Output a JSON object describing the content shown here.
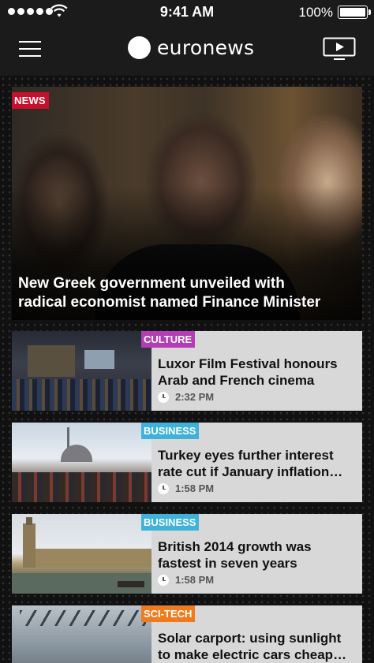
{
  "status_bar": {
    "time": "9:41 AM",
    "battery": "100%"
  },
  "header": {
    "logo_text": "euronews",
    "menu_icon": "hamburger-menu-icon",
    "video_icon": "play-video-icon"
  },
  "hero": {
    "category": "NEWS",
    "category_color": "#c8102e",
    "title_line1": "New Greek government unveiled with",
    "title_line2": "radical economist named Finance Minister"
  },
  "articles": [
    {
      "category": "CULTURE",
      "category_color": "#b43cb4",
      "title_line1": "Luxor Film Festival honours",
      "title_line2": "Arab and French cinema",
      "time": "2:32 PM"
    },
    {
      "category": "BUSINESS",
      "category_color": "#3fb2d9",
      "title_line1": "Turkey eyes further interest",
      "title_line2": "rate cut if January inflation…",
      "time": "1:58 PM"
    },
    {
      "category": "BUSINESS",
      "category_color": "#3fb2d9",
      "title_line1": "British 2014 growth was",
      "title_line2": "fastest in seven years",
      "time": "1:58 PM"
    },
    {
      "category": "SCI-TECH",
      "category_color": "#f07b1f",
      "title_line1": "Solar carport: using sunlight",
      "title_line2": "to make electric cars cheap…",
      "time": ""
    }
  ]
}
